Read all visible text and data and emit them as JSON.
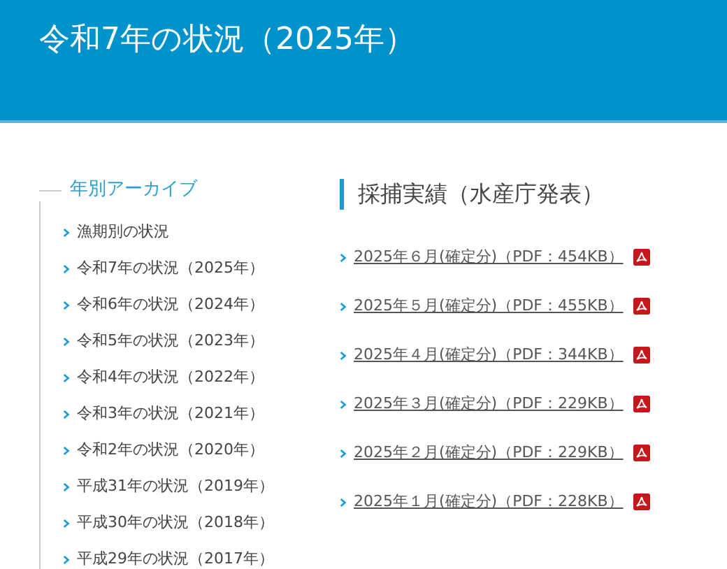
{
  "header": {
    "title": "令和7年の状況（2025年）"
  },
  "sidebar": {
    "heading": "年別アーカイブ",
    "items": [
      {
        "label": "漁期別の状況"
      },
      {
        "label": "令和7年の状況（2025年）"
      },
      {
        "label": "令和6年の状況（2024年）"
      },
      {
        "label": "令和5年の状況（2023年）"
      },
      {
        "label": "令和4年の状況（2022年）"
      },
      {
        "label": "令和3年の状況（2021年）"
      },
      {
        "label": "令和2年の状況（2020年）"
      },
      {
        "label": "平成31年の状況（2019年）"
      },
      {
        "label": "平成30年の状況（2018年）"
      },
      {
        "label": "平成29年の状況（2017年）"
      }
    ]
  },
  "main": {
    "heading": "採捕実績（水産庁発表）",
    "links": [
      {
        "label": "2025年６月(確定分)（PDF：454KB）"
      },
      {
        "label": "2025年５月(確定分)（PDF：455KB）"
      },
      {
        "label": "2025年４月(確定分)（PDF：344KB）"
      },
      {
        "label": "2025年３月(確定分)（PDF：229KB）"
      },
      {
        "label": "2025年２月(確定分)（PDF：229KB）"
      },
      {
        "label": "2025年１月(確定分)（PDF：228KB）"
      }
    ]
  }
}
